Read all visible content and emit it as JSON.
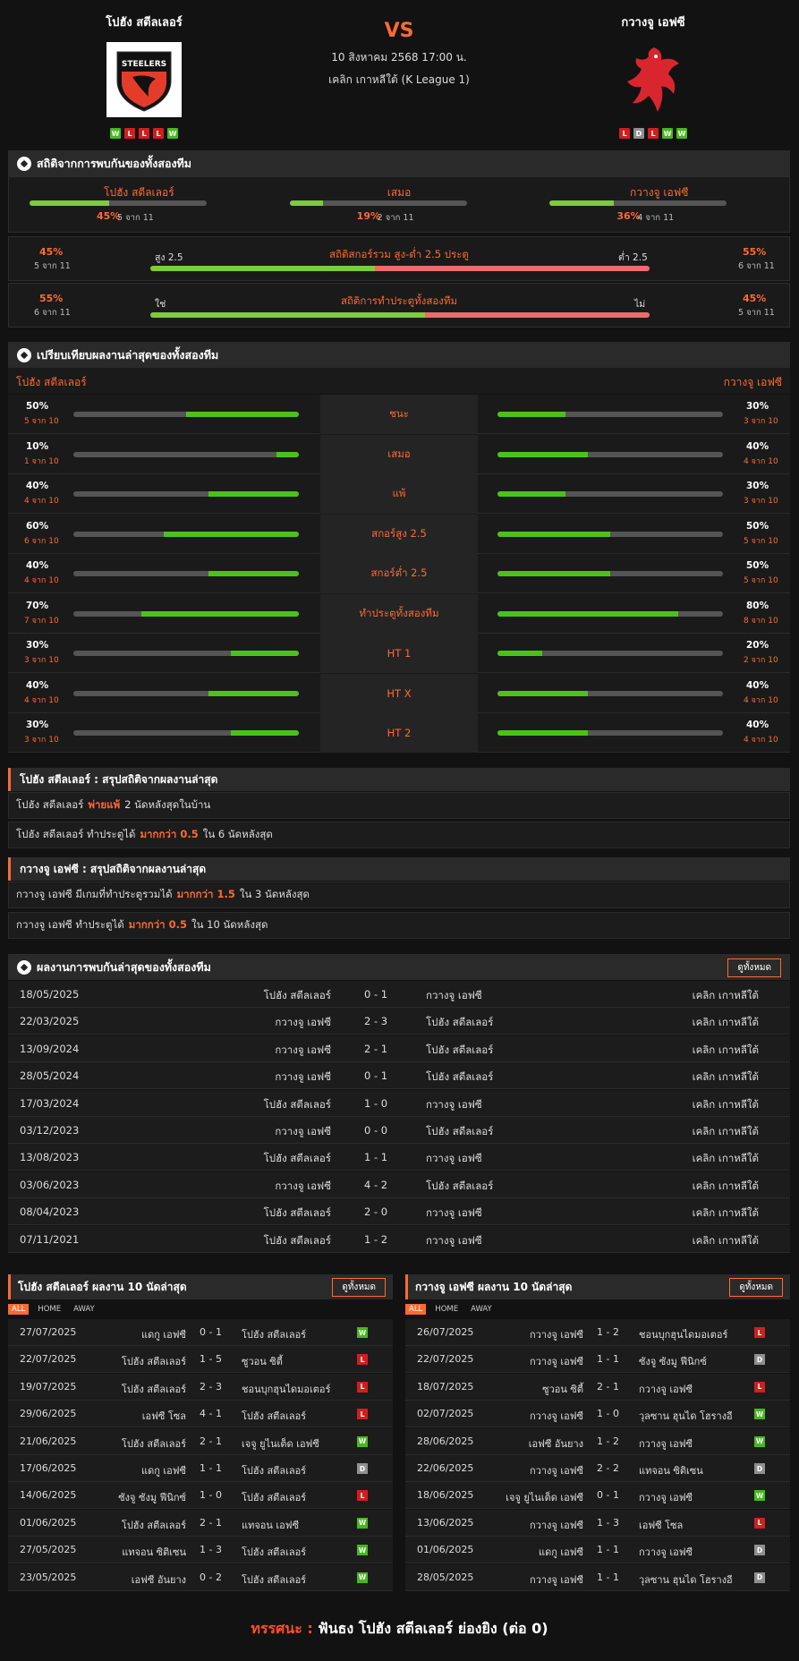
{
  "header": {
    "home_name": "โปฮัง สตีลเลอร์",
    "away_name": "กวางจู เอฟซี",
    "vs": "VS",
    "datetime": "10 สิงหาคม 2568 17:00 น.",
    "league": "เคลิก เกาหลีใต้ (K League 1)",
    "home_logo_text": "STEELERS",
    "home_form": [
      "W",
      "L",
      "L",
      "L",
      "W"
    ],
    "away_form": [
      "L",
      "D",
      "L",
      "W",
      "W"
    ]
  },
  "h2h_stats": {
    "title": "สถิติจากการพบกันของทั้งสองทีม",
    "cols": [
      {
        "label": "โปฮัง สตีลเลอร์",
        "pct": "45%",
        "sub": "5 จาก 11",
        "value": 0.45
      },
      {
        "label": "เสมอ",
        "pct": "19%",
        "sub": "2 จาก 11",
        "value": 0.19
      },
      {
        "label": "กวางจู เอฟซี",
        "pct": "36%",
        "sub": "4 จาก 11",
        "value": 0.36
      }
    ],
    "ou": {
      "title": "สถิติสกอร์รวม สูง-ต่ำ 2.5 ประตู",
      "left_pct": "45%",
      "left_sub": "5 จาก 11",
      "left_label": "สูง 2.5",
      "right_pct": "55%",
      "right_sub": "6 จาก 11",
      "right_label": "ต่ำ 2.5",
      "value": 0.45
    },
    "btts": {
      "title": "สถิติการทำประตูทั้งสองทีม",
      "left_pct": "55%",
      "left_sub": "6 จาก 11",
      "left_label": "ใช่",
      "right_pct": "45%",
      "right_sub": "5 จาก 11",
      "right_label": "ไม่",
      "value": 0.55
    }
  },
  "compare": {
    "title": "เปรียบเทียบผลงานล่าสุดของทั้งสองทีม",
    "home": "โปฮัง สตีลเลอร์",
    "away": "กวางจู เอฟซี",
    "rows": [
      {
        "label": "ชนะ",
        "lp": "50%",
        "ls": "5 จาก 10",
        "lv": 0.5,
        "rp": "30%",
        "rs": "3 จาก 10",
        "rv": 0.3
      },
      {
        "label": "เสมอ",
        "lp": "10%",
        "ls": "1 จาก 10",
        "lv": 0.1,
        "rp": "40%",
        "rs": "4 จาก 10",
        "rv": 0.4
      },
      {
        "label": "แพ้",
        "lp": "40%",
        "ls": "4 จาก 10",
        "lv": 0.4,
        "rp": "30%",
        "rs": "3 จาก 10",
        "rv": 0.3
      },
      {
        "label": "สกอร์สูง 2.5",
        "lp": "60%",
        "ls": "6 จาก 10",
        "lv": 0.6,
        "rp": "50%",
        "rs": "5 จาก 10",
        "rv": 0.5
      },
      {
        "label": "สกอร์ต่ำ 2.5",
        "lp": "40%",
        "ls": "4 จาก 10",
        "lv": 0.4,
        "rp": "50%",
        "rs": "5 จาก 10",
        "rv": 0.5
      },
      {
        "label": "ทำประตูทั้งสองทีม",
        "lp": "70%",
        "ls": "7 จาก 10",
        "lv": 0.7,
        "rp": "80%",
        "rs": "8 จาก 10",
        "rv": 0.8
      },
      {
        "label": "HT 1",
        "lp": "30%",
        "ls": "3 จาก 10",
        "lv": 0.3,
        "rp": "20%",
        "rs": "2 จาก 10",
        "rv": 0.2
      },
      {
        "label": "HT X",
        "lp": "40%",
        "ls": "4 จาก 10",
        "lv": 0.4,
        "rp": "40%",
        "rs": "4 จาก 10",
        "rv": 0.4
      },
      {
        "label": "HT 2",
        "lp": "30%",
        "ls": "3 จาก 10",
        "lv": 0.3,
        "rp": "40%",
        "rs": "4 จาก 10",
        "rv": 0.4
      }
    ]
  },
  "summary_home": {
    "title": "โปฮัง สตีลเลอร์ : สรุปสถิติจากผลงานล่าสุด",
    "line1": {
      "a": "โปฮัง สตีลเลอร์",
      "hl": "พ่ายแพ้",
      "b": "2 นัดหลังสุดในบ้าน"
    },
    "line2": {
      "a": "โปฮัง สตีลเลอร์ ทำประตูได้",
      "hl": "มากกว่า 0.5",
      "b": "ใน 6 นัดหลังสุด"
    }
  },
  "summary_away": {
    "title": "กวางจู เอฟซี : สรุปสถิติจากผลงานล่าสุด",
    "line1": {
      "a": "กวางจู เอฟซี มีเกมที่ทำประตูรวมได้",
      "hl": "มากกว่า 1.5",
      "b": "ใน 3 นัดหลังสุด"
    },
    "line2": {
      "a": "กวางจู เอฟซี ทำประตูได้",
      "hl": "มากกว่า 0.5",
      "b": "ใน 10 นัดหลังสุด"
    }
  },
  "h2h_results": {
    "title": "ผลงานการพบกันล่าสุดของทั้งสองทีม",
    "view_all": "ดูทั้งหมด",
    "rows": [
      {
        "date": "18/05/2025",
        "home": "โปฮัง สตีลเลอร์",
        "score": "0 - 1",
        "away": "กวางจู เอฟซี",
        "league": "เคลิก เกาหลีใต้"
      },
      {
        "date": "22/03/2025",
        "home": "กวางจู เอฟซี",
        "score": "2 - 3",
        "away": "โปฮัง สตีลเลอร์",
        "league": "เคลิก เกาหลีใต้"
      },
      {
        "date": "13/09/2024",
        "home": "กวางจู เอฟซี",
        "score": "2 - 1",
        "away": "โปฮัง สตีลเลอร์",
        "league": "เคลิก เกาหลีใต้"
      },
      {
        "date": "28/05/2024",
        "home": "กวางจู เอฟซี",
        "score": "0 - 1",
        "away": "โปฮัง สตีลเลอร์",
        "league": "เคลิก เกาหลีใต้"
      },
      {
        "date": "17/03/2024",
        "home": "โปฮัง สตีลเลอร์",
        "score": "1 - 0",
        "away": "กวางจู เอฟซี",
        "league": "เคลิก เกาหลีใต้"
      },
      {
        "date": "03/12/2023",
        "home": "กวางจู เอฟซี",
        "score": "0 - 0",
        "away": "โปฮัง สตีลเลอร์",
        "league": "เคลิก เกาหลีใต้"
      },
      {
        "date": "13/08/2023",
        "home": "โปฮัง สตีลเลอร์",
        "score": "1 - 1",
        "away": "กวางจู เอฟซี",
        "league": "เคลิก เกาหลีใต้"
      },
      {
        "date": "03/06/2023",
        "home": "กวางจู เอฟซี",
        "score": "4 - 2",
        "away": "โปฮัง สตีลเลอร์",
        "league": "เคลิก เกาหลีใต้"
      },
      {
        "date": "08/04/2023",
        "home": "โปฮัง สตีลเลอร์",
        "score": "2 - 0",
        "away": "กวางจู เอฟซี",
        "league": "เคลิก เกาหลีใต้"
      },
      {
        "date": "07/11/2021",
        "home": "โปฮัง สตีลเลอร์",
        "score": "1 - 2",
        "away": "กวางจู เอฟซี",
        "league": "เคลิก เกาหลีใต้"
      }
    ]
  },
  "last10_home": {
    "title": "โปฮัง สตีลเลอร์ ผลงาน 10 นัดล่าสุด",
    "view_all": "ดูทั้งหมด",
    "tabs": [
      "ALL",
      "HOME",
      "AWAY"
    ],
    "rows": [
      {
        "date": "27/07/2025",
        "home": "แดกู เอฟซี",
        "score": "0 - 1",
        "away": "โปฮัง สตีลเลอร์",
        "res": "W"
      },
      {
        "date": "22/07/2025",
        "home": "โปฮัง สตีลเลอร์",
        "score": "1 - 5",
        "away": "ซูวอน ซิตี้",
        "res": "L"
      },
      {
        "date": "19/07/2025",
        "home": "โปฮัง สตีลเลอร์",
        "score": "2 - 3",
        "away": "ชอนบุกฮุนไดมอเตอร์",
        "res": "L"
      },
      {
        "date": "29/06/2025",
        "home": "เอฟซี โซล",
        "score": "4 - 1",
        "away": "โปฮัง สตีลเลอร์",
        "res": "L"
      },
      {
        "date": "21/06/2025",
        "home": "โปฮัง สตีลเลอร์",
        "score": "2 - 1",
        "away": "เจจู ยูไนเต็ด เอฟซี",
        "res": "W"
      },
      {
        "date": "17/06/2025",
        "home": "แดกู เอฟซี",
        "score": "1 - 1",
        "away": "โปฮัง สตีลเลอร์",
        "res": "D"
      },
      {
        "date": "14/06/2025",
        "home": "ซังจู ซังมู ฟีนิกซ์",
        "score": "1 - 0",
        "away": "โปฮัง สตีลเลอร์",
        "res": "L"
      },
      {
        "date": "01/06/2025",
        "home": "โปฮัง สตีลเลอร์",
        "score": "2 - 1",
        "away": "แทจอน เอฟซี",
        "res": "W"
      },
      {
        "date": "27/05/2025",
        "home": "แทจอน ซิติเซน",
        "score": "1 - 3",
        "away": "โปฮัง สตีลเลอร์",
        "res": "W"
      },
      {
        "date": "23/05/2025",
        "home": "เอฟซี อันยาง",
        "score": "0 - 2",
        "away": "โปฮัง สตีลเลอร์",
        "res": "W"
      }
    ]
  },
  "last10_away": {
    "title": "กวางจู เอฟซี ผลงาน 10 นัดล่าสุด",
    "view_all": "ดูทั้งหมด",
    "tabs": [
      "ALL",
      "HOME",
      "AWAY"
    ],
    "rows": [
      {
        "date": "26/07/2025",
        "home": "กวางจู เอฟซี",
        "score": "1 - 2",
        "away": "ชอนบุกฮุนไดมอเตอร์",
        "res": "L"
      },
      {
        "date": "22/07/2025",
        "home": "กวางจู เอฟซี",
        "score": "1 - 1",
        "away": "ซังจู ซังมู ฟีนิกซ์",
        "res": "D"
      },
      {
        "date": "18/07/2025",
        "home": "ซูวอน ซิตี้",
        "score": "2 - 1",
        "away": "กวางจู เอฟซี",
        "res": "L"
      },
      {
        "date": "02/07/2025",
        "home": "กวางจู เอฟซี",
        "score": "1 - 0",
        "away": "วุลซาน ฮุนได โฮรางอี",
        "res": "W"
      },
      {
        "date": "28/06/2025",
        "home": "เอฟซี อันยาง",
        "score": "1 - 2",
        "away": "กวางจู เอฟซี",
        "res": "W"
      },
      {
        "date": "22/06/2025",
        "home": "กวางจู เอฟซี",
        "score": "2 - 2",
        "away": "แทจอน ซิติเซน",
        "res": "D"
      },
      {
        "date": "18/06/2025",
        "home": "เจจู ยูไนเต็ด เอฟซี",
        "score": "0 - 1",
        "away": "กวางจู เอฟซี",
        "res": "W"
      },
      {
        "date": "13/06/2025",
        "home": "กวางจู เอฟซี",
        "score": "1 - 3",
        "away": "เอฟซี โซล",
        "res": "L"
      },
      {
        "date": "01/06/2025",
        "home": "แดกู เอฟซี",
        "score": "1 - 1",
        "away": "กวางจู เอฟซี",
        "res": "D"
      },
      {
        "date": "28/05/2025",
        "home": "กวางจู เอฟซี",
        "score": "1 - 1",
        "away": "วุลซาน ฮุนได โฮรางอี",
        "res": "D"
      }
    ]
  },
  "footer": {
    "label": "ทรรศนะ :",
    "text": "ฟันธง โปฮัง สตีลเลอร์ ย่องยิง (ต่อ 0)"
  },
  "colors": {
    "accent": "#ff6a33",
    "win": "#47b81c",
    "loss": "#d11e1e",
    "draw": "#8f8f8f",
    "green_bar": "#7ecb3b",
    "red_bar": "#ee6b6b"
  }
}
